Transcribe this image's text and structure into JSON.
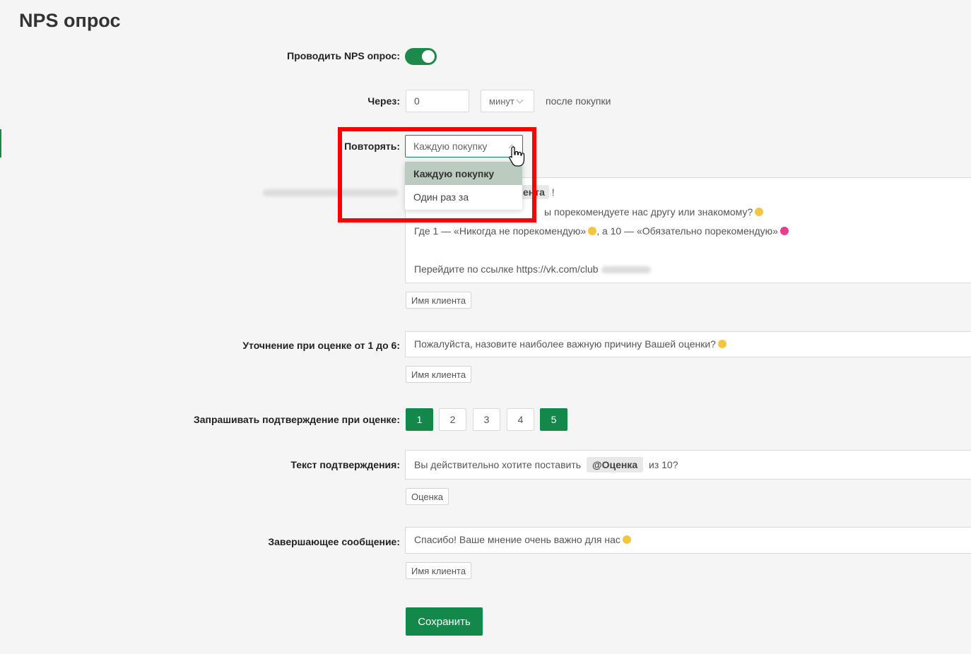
{
  "title": "NPS опрос",
  "nps_toggle": {
    "label": "Проводить NPS опрос:",
    "enabled": true
  },
  "delay": {
    "label": "Через:",
    "value": "0",
    "unit": "минут",
    "suffix": "после покупки"
  },
  "repeat": {
    "label": "Повторять:",
    "selected": "Каждую покупку",
    "options": [
      "Каждую покупку",
      "Один раз за"
    ]
  },
  "message": {
    "chip": "ента",
    "chip_after": "!",
    "line_question": "ы порекомендуете нас другу или знакомому?",
    "line_scale": "Где 1 — «Никогда не порекомендую»",
    "line_scale_mid": ", а 10 — «Обязательно порекомендую»",
    "line_link": "Перейдите по ссылке https://vk.com/club",
    "tag": "Имя клиента"
  },
  "clarify": {
    "label": "Уточнение при оценке от 1 до 6:",
    "value": "Пожалуйста, назовите наиболее важную причину Вашей оценки?",
    "tag": "Имя клиента"
  },
  "confirm_rating": {
    "label": "Запрашивать подтверждение при оценке:",
    "buttons": [
      "1",
      "2",
      "3",
      "4",
      "5"
    ],
    "active": [
      "1",
      "5"
    ]
  },
  "confirm_text": {
    "label": "Текст подтверждения:",
    "before": "Вы действительно хотите поставить",
    "chip": "@Оценка",
    "after": "из 10?",
    "tag": "Оценка"
  },
  "final_message": {
    "label": "Завершающее сообщение:",
    "value": "Спасибо! Ваше мнение очень важно для нас",
    "tag": "Имя клиента"
  },
  "save_label": "Сохранить",
  "colors": {
    "accent": "#14884a",
    "highlight": "#ff0000",
    "selected_option": "#bccbbf"
  }
}
